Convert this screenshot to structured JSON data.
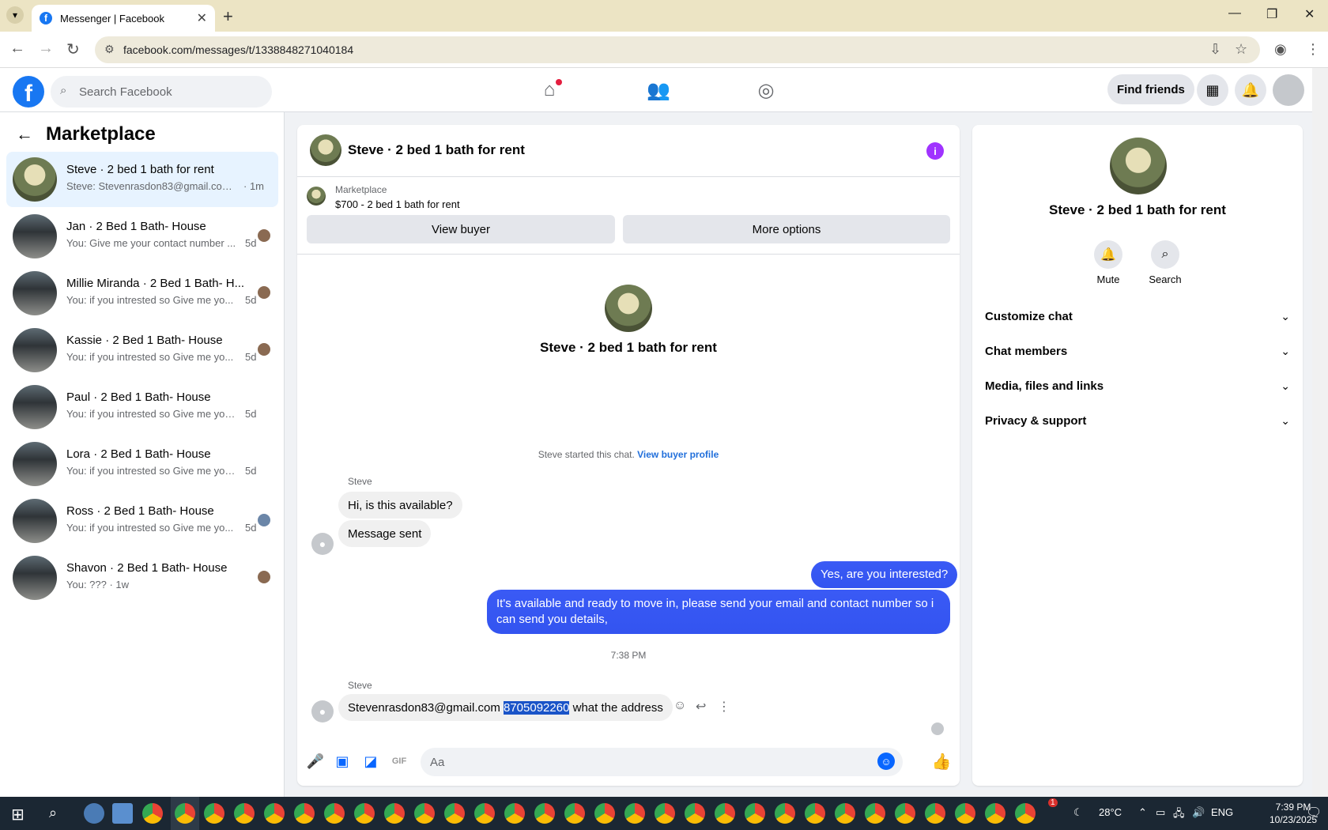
{
  "browser": {
    "tab_title": "Messenger | Facebook",
    "url": "facebook.com/messages/t/1338848271040184",
    "new_tab": "+",
    "window_controls": [
      "minimize-icon",
      "restore-icon",
      "close-icon"
    ]
  },
  "fbnav": {
    "search_placeholder": "Search Facebook",
    "find_friends": "Find friends",
    "icons": [
      "home-icon",
      "friends-icon",
      "groups-icon",
      "menu-grid-icon",
      "bell-icon",
      "profile-avatar"
    ]
  },
  "left": {
    "title": "Marketplace",
    "conversations": [
      {
        "name": "Steve · 2 bed 1 bath for rent",
        "preview": "Steve: Stevenrasdon83@gmail.com 8...",
        "time": "· 1m",
        "active": true
      },
      {
        "name": "Jan · 2 Bed 1 Bath- House",
        "preview": "You: Give me your contact number ...",
        "time": "5d"
      },
      {
        "name": "Millie Miranda · 2 Bed 1 Bath- H...",
        "preview": "You: if you intrested so Give me yo...",
        "time": "5d"
      },
      {
        "name": "Kassie · 2 Bed 1 Bath- House",
        "preview": "You: if you intrested so Give me yo...",
        "time": "5d"
      },
      {
        "name": "Paul · 2 Bed 1 Bath- House",
        "preview": "You: if you intrested so Give me your ...",
        "time": "5d"
      },
      {
        "name": "Lora · 2 Bed 1 Bath- House",
        "preview": "You: if you intrested so Give me your ...",
        "time": "5d"
      },
      {
        "name": "Ross · 2 Bed 1 Bath- House",
        "preview": "You: if you intrested so Give me yo...",
        "time": "5d"
      },
      {
        "name": "Shavon · 2 Bed 1 Bath- House",
        "preview": "You: ??? · 1w",
        "time": ""
      }
    ]
  },
  "chat": {
    "header_title": "Steve · 2 bed 1 bath for rent",
    "marketplace_label": "Marketplace",
    "listing": "$700 - 2 bed 1 bath for rent",
    "view_buyer": "View buyer",
    "more_options": "More options",
    "intro_name": "Steve · 2 bed 1 bath for rent",
    "started_text": "Steve started this chat.",
    "view_buyer_profile": "View buyer profile",
    "sender": "Steve",
    "msg1": "Hi, is this available?",
    "msg2": "Message sent",
    "out1": "Yes, are you interested?",
    "out2": "It's available and ready to move in, please send your email and contact number so i can send you details,",
    "time_sep": "7:38 PM",
    "msg3_email": "Stevenrasdon83@gmail.com",
    "msg3_phone": "8705092260",
    "msg3_rest": "what the address",
    "composer_placeholder": "Aa"
  },
  "right": {
    "name": "Steve · 2 bed 1 bath for rent",
    "mute": "Mute",
    "search": "Search",
    "rows": [
      "Customize chat",
      "Chat members",
      "Media, files and links",
      "Privacy & support"
    ]
  },
  "taskbar": {
    "temperature": "28°C",
    "lang": "ENG",
    "time": "7:39 PM",
    "date": "10/23/2025",
    "weather_badge": "1"
  }
}
